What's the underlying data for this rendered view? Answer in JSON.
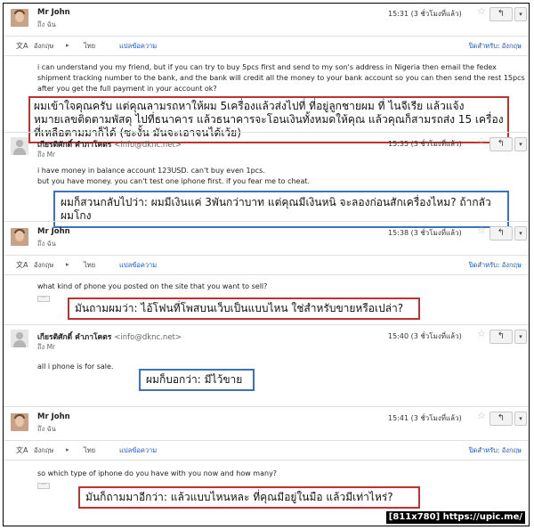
{
  "thread": [
    {
      "sender": "Mr John",
      "email": "",
      "to": "ถึง ฉัน",
      "time": "15:31 (3 ชั่วโมงที่แล้ว)",
      "translate_bar": true,
      "body": "i can understand you my friend, but if you can try to buy 5pcs first and send to my son's address in Nigeria then email the fedex shipment tracking number to the bank, and the bank will credit all the money to your bank account so you can then send the rest 15pcs after you get the full payment in your account ok?",
      "annotation": "ผมเข้าใจคุณครับ แต่คุณลามรถหาให้ผม 5เครื่องแล้วส่งไปที่ ที่อยู่ลูกชายผม ที่ ไนจีเรีย แล้วแจ้งหมายเลขติดตามพัสดุ ไปที่ธนาคาร แล้วธนาคารจะโอนเงินทั้งหมดให้คุณ แล้วคุณก็สามรถส่ง 15 เครื่องที่เหลือตามมาก็ได้ (ซะงั้น มันจะเอาจนได้เว้ย)"
    },
    {
      "sender": "เกียรติศักดิ์ คำภาโคตร",
      "email": "<info@dknc.net>",
      "to": "ถึง Mr",
      "time": "15:35 (3 ชั่วโมงที่แล้ว)",
      "translate_bar": false,
      "body": "i have money in balance account 123USD. can't buy even 1pcs.\nbut you have money. you can't test one iphone first. if you fear me to cheat.",
      "annotation": "ผมก็สวนกลับไปว่า: ผมมีเงินแค่ 3พันกว่าบาท แต่คุณมีเงินหนิ จะลองก่อนสักเครื่องไหม? ถ้ากลัวผมโกง"
    },
    {
      "sender": "Mr John",
      "email": "",
      "to": "ถึง ฉัน",
      "time": "15:38 (3 ชั่วโมงที่แล้ว)",
      "translate_bar": true,
      "body": "what kind of phone you posted on the site that you want to sell?",
      "annotation": "มันถามผมว่า: ไอ้โฟนที่โพสบนเว็บเป็นแบบไหน ใช่สำหรับขายหรือเปล่า?"
    },
    {
      "sender": "เกียรติศักดิ์ คำภาโคตร",
      "email": "<info@dknc.net>",
      "to": "ถึง Mr",
      "time": "15:40 (3 ชั่วโมงที่แล้ว)",
      "translate_bar": false,
      "body": "all i phone is for sale.",
      "annotation": "ผมก็บอกว่า: มีไว้ขาย"
    },
    {
      "sender": "Mr John",
      "email": "",
      "to": "ถึง ฉัน",
      "time": "15:41 (3 ชั่วโมงที่แล้ว)",
      "translate_bar": true,
      "body": "so which type of iphone do you have with you now and how many?",
      "annotation": "มันก็ถามมาอีกว่า: แล้วแบบไหนหละ ที่คุณมีอยู่ในมือ แล้วมีเท่าไหร่?"
    }
  ],
  "translate_bar": {
    "source_lang": "อังกฤษ",
    "target_lang": "ไทย",
    "translate_link": "แปลข้อความ",
    "turn_off": "ปิดสำหรับ: อังกฤษ"
  },
  "icons": {
    "star": "☆",
    "reply": "↰",
    "more": "▾",
    "translate": "文A",
    "dots": "···"
  },
  "watermark": "[811x780] https://upic.me/",
  "colors": {
    "annotation_red": "#c0312f",
    "annotation_blue": "#3b73b9",
    "link": "#1155cc"
  }
}
